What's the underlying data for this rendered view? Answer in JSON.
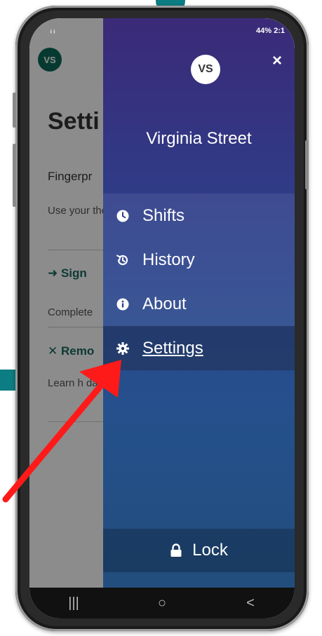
{
  "status_bar": {
    "left": "ᵢ ᵢ",
    "right": "44% 2:1"
  },
  "background_page": {
    "avatar": "VS",
    "title": "Setti",
    "section": "Fingerpr",
    "text1": "Use your the app.",
    "link1": "Sign",
    "text2": "Complete",
    "link2": "Remo",
    "text3": "Learn h data."
  },
  "drawer": {
    "avatar": "VS",
    "close_label": "×",
    "user_name": "Virginia Street",
    "menu": [
      {
        "label": "Shifts",
        "icon": "clock-icon"
      },
      {
        "label": "History",
        "icon": "history-icon"
      },
      {
        "label": "About",
        "icon": "info-icon"
      },
      {
        "label": "Settings",
        "icon": "gear-icon",
        "active": true
      }
    ],
    "lock_label": "Lock"
  },
  "nav_bar": {
    "recent": "|||",
    "home": "○",
    "back": "<"
  },
  "colors": {
    "drawer_top": "#3b2a78",
    "drawer_bottom": "#214d7a",
    "accent": "#0c7d82",
    "arrow": "#ff1a1a"
  }
}
